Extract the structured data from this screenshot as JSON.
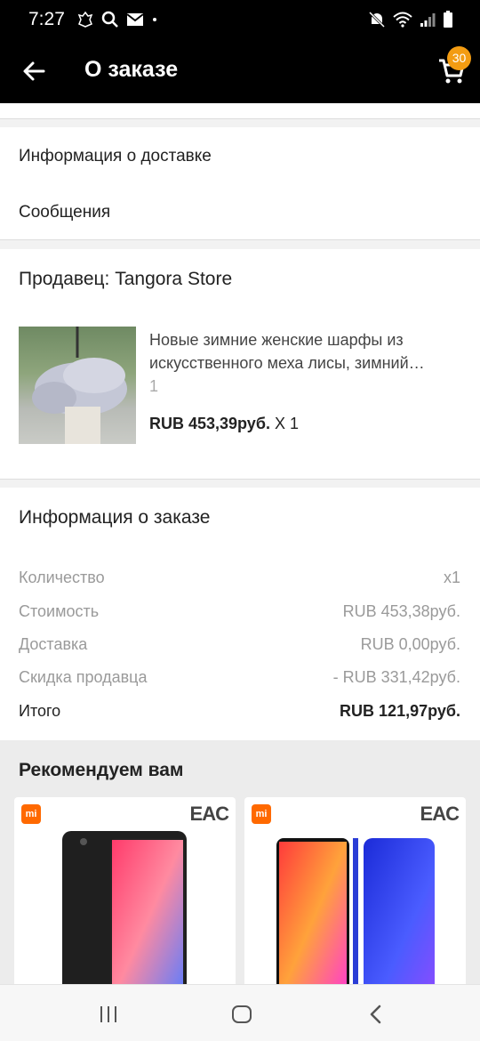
{
  "status_bar": {
    "time": "7:27",
    "left_icons": [
      "coat-of-arms-icon",
      "search-icon",
      "mail-icon",
      "dot-icon"
    ],
    "right_icons": [
      "mute-icon",
      "wifi-icon",
      "signal-icon",
      "battery-icon"
    ]
  },
  "app_bar": {
    "title": "О заказе",
    "cart_badge": "30",
    "badge_color": "#f39c12"
  },
  "menu": {
    "delivery_info": "Информация о доставке",
    "messages": "Сообщения"
  },
  "seller": {
    "label": "Продавец: Tangora Store",
    "product": {
      "name": "Новые зимние женские шарфы из искусственного меха лисы, зимний…",
      "quantity": "1",
      "price": "RUB 453,39руб.",
      "multiplier": "X 1"
    }
  },
  "order_info": {
    "title": "Информация о заказе",
    "rows": [
      {
        "label": "Количество",
        "value": "x1"
      },
      {
        "label": "Стоимость",
        "value": "RUB 453,38руб."
      },
      {
        "label": "Доставка",
        "value": "RUB 0,00руб."
      },
      {
        "label": "Скидка продавца",
        "value": "- RUB 331,42руб."
      }
    ],
    "total_label": "Итого",
    "total_value": "RUB 121,97руб."
  },
  "recommendations": {
    "title": "Рекомендуем вам",
    "cards": [
      {
        "brand_icon": "mi-logo",
        "cert": "EAC",
        "mi_text": "mi"
      },
      {
        "brand_icon": "mi-logo",
        "cert": "EAC",
        "mi_text": "mi"
      }
    ]
  },
  "nav_bar": {
    "buttons": [
      "recents-icon",
      "home-icon",
      "back-nav-icon"
    ]
  }
}
